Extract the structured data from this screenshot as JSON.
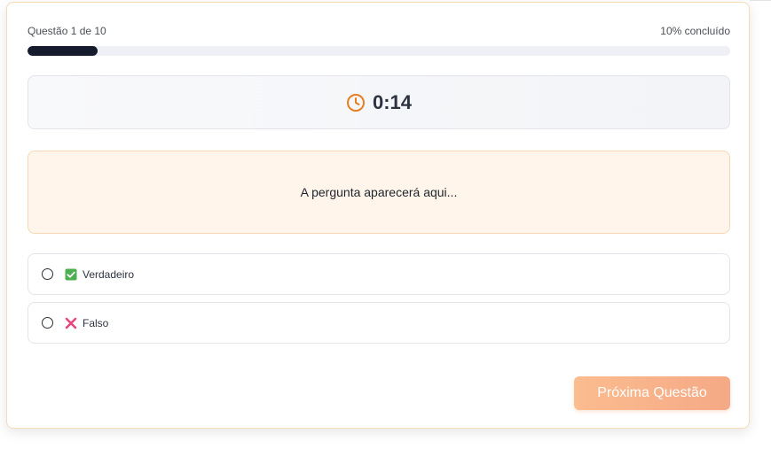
{
  "progress": {
    "question_label": "Questão 1 de 10",
    "percent_label": "10% concluído",
    "fraction": 0.1
  },
  "timer": {
    "icon": "clock-icon",
    "value": "0:14",
    "accent_color": "#e67e22"
  },
  "question": {
    "text": "A pergunta aparecerá aqui..."
  },
  "options": [
    {
      "icon": "check-box-icon",
      "icon_color": "#4caf50",
      "label": "Verdadeiro",
      "selected": false
    },
    {
      "icon": "cross-icon",
      "icon_color": "#e8467c",
      "label": "Falso",
      "selected": false
    }
  ],
  "actions": {
    "next_label": "Próxima Questão",
    "next_color": "#f7b08a"
  }
}
